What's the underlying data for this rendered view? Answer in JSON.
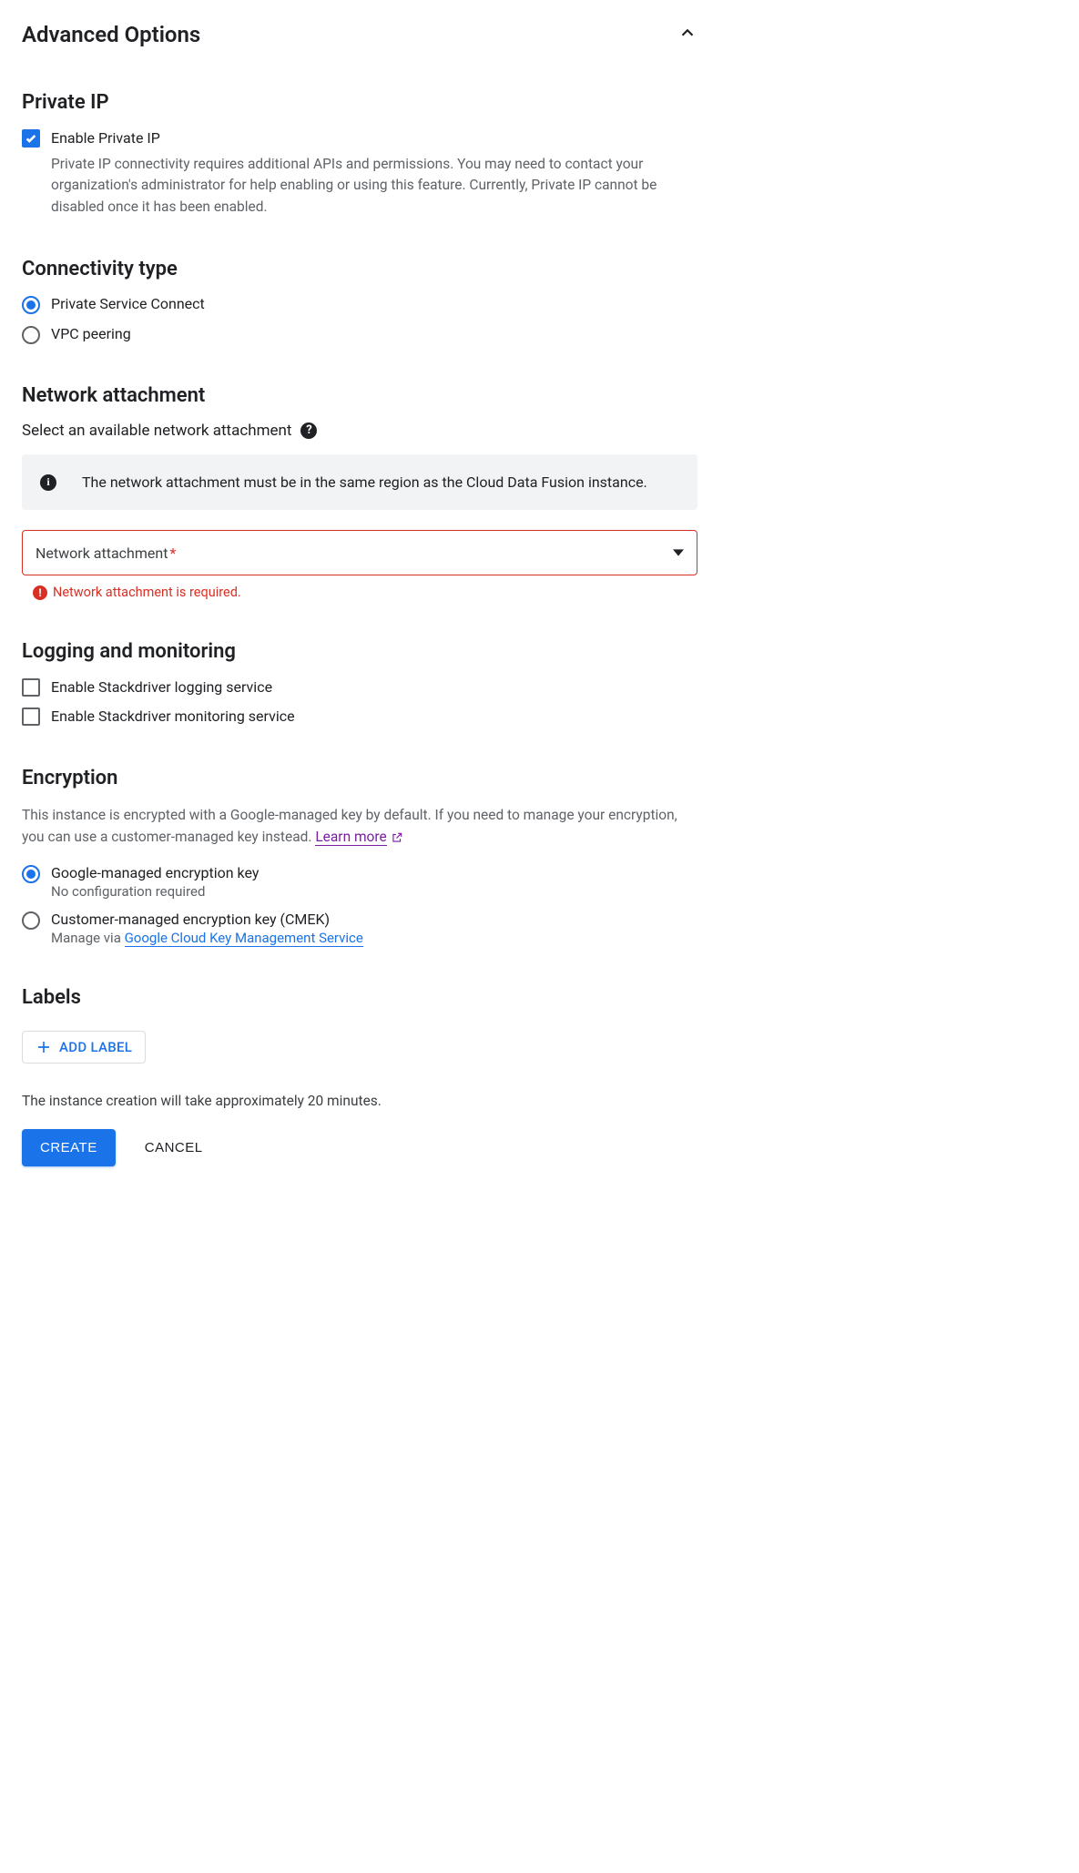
{
  "header": {
    "title": "Advanced Options"
  },
  "private_ip": {
    "heading": "Private IP",
    "checkbox_label": "Enable Private IP",
    "checkbox_checked": true,
    "description": "Private IP connectivity requires additional APIs and permissions. You may need to contact your organization's administrator for help enabling or using this feature. Currently, Private IP cannot be disabled once it has been enabled."
  },
  "connectivity": {
    "heading": "Connectivity type",
    "options": [
      {
        "label": "Private Service Connect",
        "selected": true
      },
      {
        "label": "VPC peering",
        "selected": false
      }
    ]
  },
  "network_attachment": {
    "heading": "Network attachment",
    "subtext": "Select an available network attachment",
    "info_text": "The network attachment must be in the same region as the Cloud Data Fusion instance.",
    "select_placeholder": "Network attachment",
    "required": true,
    "error": "Network attachment is required."
  },
  "logging": {
    "heading": "Logging and monitoring",
    "options": [
      {
        "label": "Enable Stackdriver logging service",
        "checked": false
      },
      {
        "label": "Enable Stackdriver monitoring service",
        "checked": false
      }
    ]
  },
  "encryption": {
    "heading": "Encryption",
    "description_pre": "This instance is encrypted with a Google-managed key by default. If you need to manage your encryption, you can use a customer-managed key instead. ",
    "learn_more": "Learn more",
    "options": [
      {
        "label": "Google-managed encryption key",
        "subtext": "No configuration required",
        "selected": true
      },
      {
        "label": "Customer-managed encryption key (CMEK)",
        "subtext_pre": "Manage via ",
        "subtext_link": "Google Cloud Key Management Service",
        "selected": false
      }
    ]
  },
  "labels": {
    "heading": "Labels",
    "add_button": "ADD LABEL"
  },
  "footer": {
    "notice": "The instance creation will take approximately 20 minutes.",
    "create": "CREATE",
    "cancel": "CANCEL"
  }
}
